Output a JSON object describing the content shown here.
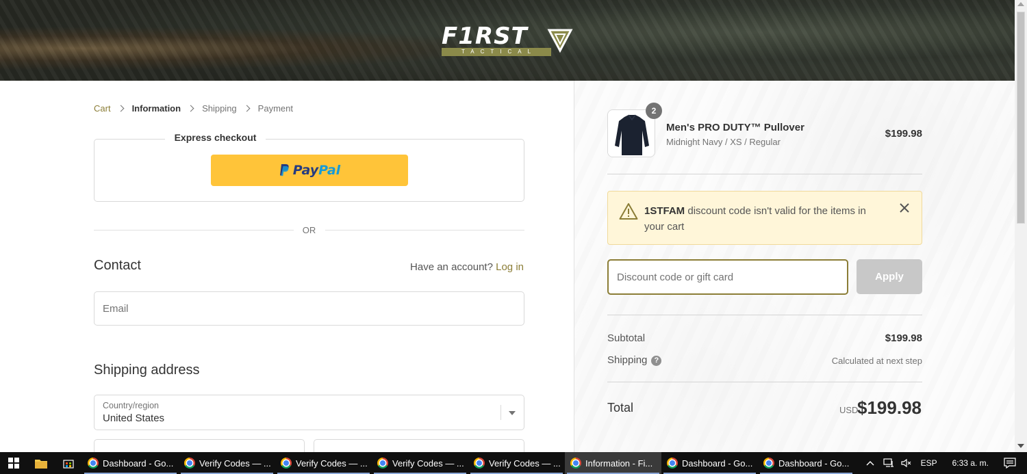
{
  "brand": {
    "logo_word": "F1RST",
    "logo_sub": "TACTICAL"
  },
  "breadcrumb": [
    {
      "label": "Cart",
      "state": "link"
    },
    {
      "label": "Information",
      "state": "current"
    },
    {
      "label": "Shipping",
      "state": "upcoming"
    },
    {
      "label": "Payment",
      "state": "upcoming"
    }
  ],
  "express": {
    "title": "Express checkout",
    "paypal_pay": "Pay",
    "paypal_pal": "Pal"
  },
  "divider_or": "OR",
  "contact": {
    "heading": "Contact",
    "account_prompt": "Have an account?",
    "login_label": "Log in",
    "email_placeholder": "Email"
  },
  "shipping": {
    "heading": "Shipping address",
    "country_label": "Country/region",
    "country_value": "United States"
  },
  "order": {
    "item": {
      "quantity": "2",
      "name": "Men's PRO DUTY™ Pullover",
      "variant": "Midnight Navy / XS / Regular",
      "price": "$199.98"
    },
    "alert": {
      "code": "1STFAM",
      "message": " discount code isn't valid for the items in your cart"
    },
    "discount_placeholder": "Discount code or gift card",
    "apply_label": "Apply",
    "subtotal_label": "Subtotal",
    "subtotal_value": "$199.98",
    "shipping_label": "Shipping",
    "shipping_value": "Calculated at next step",
    "total_label": "Total",
    "total_currency": "USD",
    "total_value": "$199.98"
  },
  "taskbar": {
    "items": [
      {
        "label": "Dashboard - Go...",
        "active": false
      },
      {
        "label": "Verify Codes — ...",
        "active": false
      },
      {
        "label": "Verify Codes — ...",
        "active": false
      },
      {
        "label": "Verify Codes — ...",
        "active": false
      },
      {
        "label": "Verify Codes — ...",
        "active": false
      },
      {
        "label": "Information - Fi...",
        "active": true
      },
      {
        "label": "Dashboard - Go...",
        "active": false
      },
      {
        "label": "Dashboard - Go...",
        "active": false
      }
    ],
    "language": "ESP",
    "clock": "6:33 a. m."
  },
  "colors": {
    "accent": "#8b7d36",
    "paypal_yellow": "#ffc439",
    "alert_bg": "#fff6d9",
    "apply_disabled": "#c8c8c8"
  }
}
